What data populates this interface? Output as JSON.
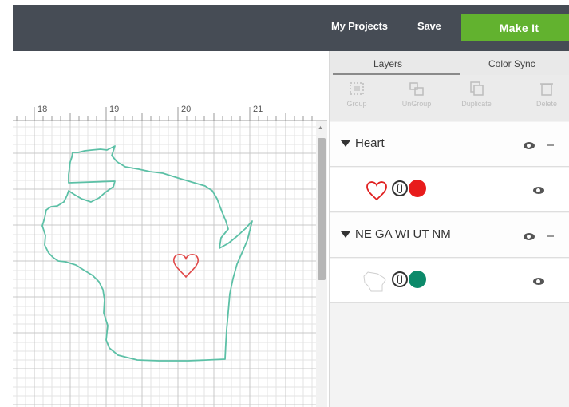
{
  "header": {
    "my_projects": "My Projects",
    "save": "Save",
    "make_it": "Make It"
  },
  "ruler": {
    "marks": [
      "18",
      "19",
      "20",
      "21"
    ]
  },
  "panel": {
    "tabs": [
      "Layers",
      "Color Sync"
    ],
    "toolbar": [
      "Group",
      "UnGroup",
      "Duplicate",
      "Delete"
    ],
    "groups": [
      {
        "label": "Heart",
        "layer_color": "#e02020"
      },
      {
        "label": "NE GA WI UT NM",
        "layer_color": "#0c8a6a"
      }
    ]
  },
  "colors": {
    "topbar": "#464c55",
    "make_it": "#62b22f",
    "wisconsin_outline": "#5cc0a6",
    "heart_outline": "#e04848"
  }
}
